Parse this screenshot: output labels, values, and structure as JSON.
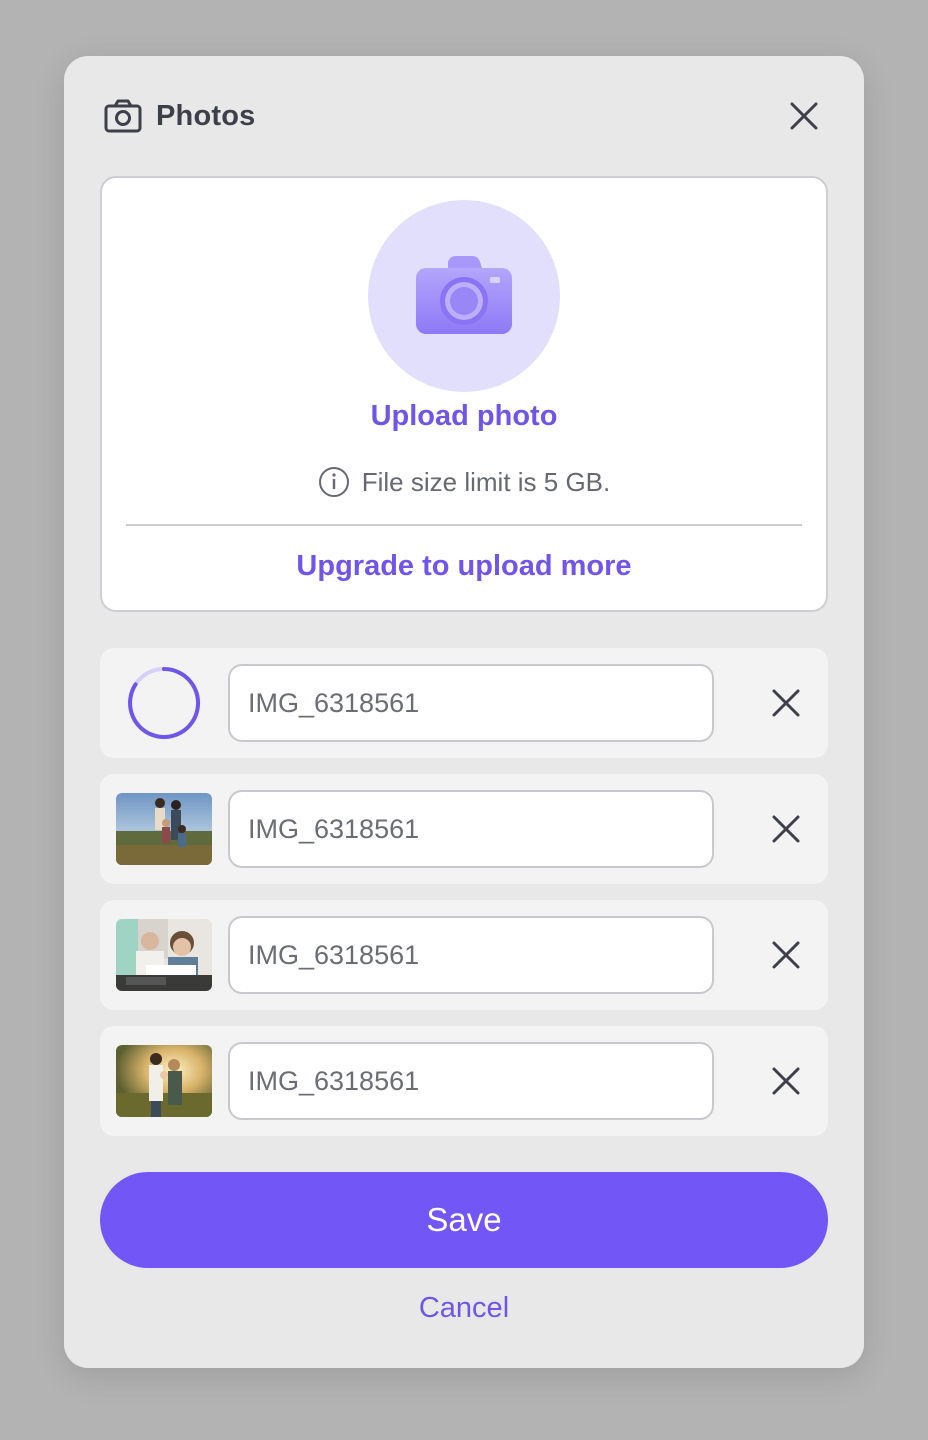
{
  "header": {
    "title": "Photos",
    "camera_icon": "camera-outline-icon",
    "close_icon": "close-icon"
  },
  "upload": {
    "icon": "camera-icon",
    "label": "Upload photo",
    "limit_icon": "info-icon",
    "limit_text": "File size limit is 5 GB.",
    "upgrade_label": "Upgrade to upload more"
  },
  "files": [
    {
      "name": "IMG_6318561",
      "status": "uploading",
      "thumbnail": "loading-spinner"
    },
    {
      "name": "IMG_6318561",
      "status": "uploaded",
      "thumbnail": "family-photo"
    },
    {
      "name": "IMG_6318561",
      "status": "uploaded",
      "thumbnail": "mother-child-reading-photo"
    },
    {
      "name": "IMG_6318561",
      "status": "uploaded",
      "thumbnail": "couple-with-baby-photo"
    }
  ],
  "actions": {
    "save_label": "Save",
    "cancel_label": "Cancel"
  },
  "colors": {
    "accent": "#7357f6",
    "accent_text": "#6f56e8",
    "accent_light": "#e2dffd",
    "modal_bg": "#e8e8e9",
    "backdrop": "#b3b3b3"
  }
}
